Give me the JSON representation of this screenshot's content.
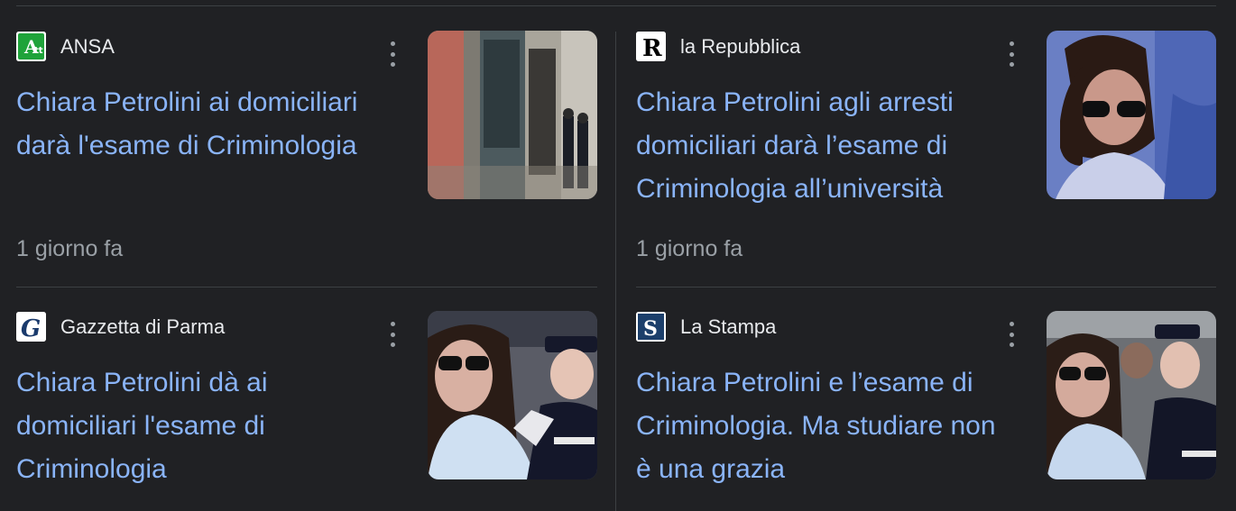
{
  "articles": [
    {
      "source": "ANSA",
      "logo_text": "A",
      "logo_color": "#1fa33a",
      "headline_lines": [
        "Chiara Petrolini ai domiciliari",
        "darà l'esame di Criminologia"
      ],
      "time": "1 giorno fa",
      "thumb_icon": "building-with-officers-photo"
    },
    {
      "source": "la Repubblica",
      "logo_text": "R",
      "logo_color": "#ffffff",
      "headline_lines": [
        "Chiara Petrolini agli arresti",
        "domiciliari darà l’esame di",
        "Criminologia all’università"
      ],
      "time": "1 giorno fa",
      "thumb_icon": "woman-sunglasses-photo"
    },
    {
      "source": "Gazzetta di Parma",
      "logo_text": "G",
      "logo_color": "#ffffff",
      "headline_lines": [
        "Chiara Petrolini dà ai",
        "domiciliari l'esame di",
        "Criminologia"
      ],
      "thumb_icon": "woman-with-carabiniere-photo"
    },
    {
      "source": "La Stampa",
      "logo_text": "S",
      "logo_color": "#1c3f6b",
      "headline_lines": [
        "Chiara Petrolini e l’esame di",
        "Criminologia. Ma studiare non",
        "è una grazia"
      ],
      "thumb_icon": "woman-in-crowd-photo"
    }
  ]
}
